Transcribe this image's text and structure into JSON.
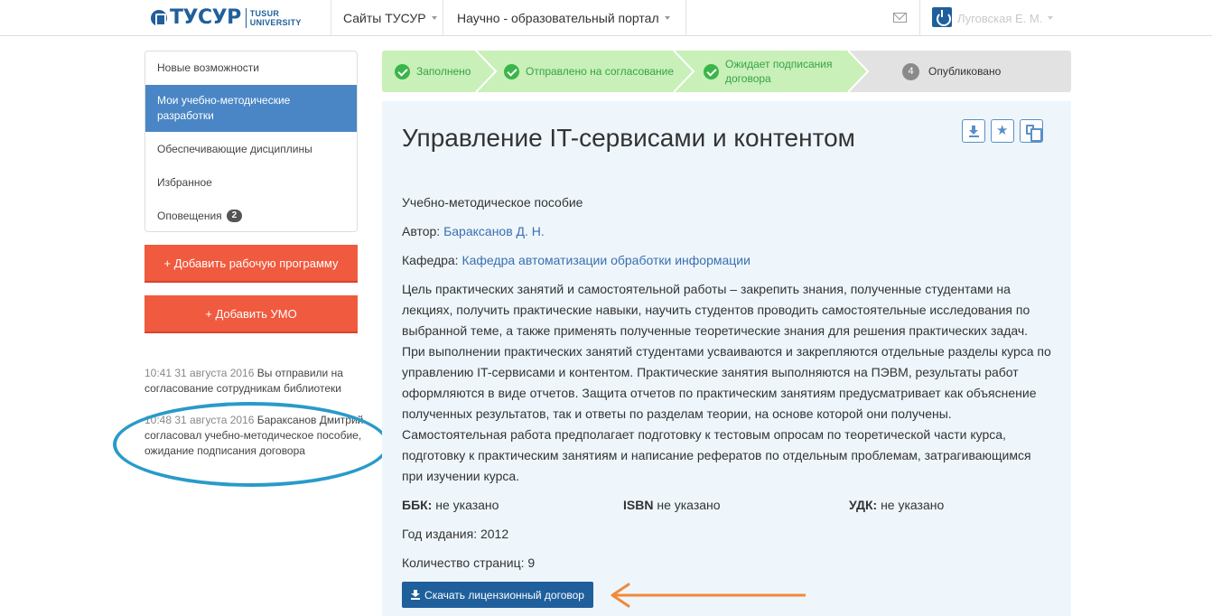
{
  "header": {
    "logo_main": "ТУСУР",
    "logo_sub_1": "TUSUR",
    "logo_sub_2": "UNIVERSITY",
    "menu": [
      "Сайты ТУСУР",
      "Научно - образовательный портал"
    ],
    "user": "Луговская Е. М."
  },
  "sidebar": {
    "items": [
      {
        "label": "Новые возможности"
      },
      {
        "label": "Мои учебно-методические разработки"
      },
      {
        "label": "Обеспечивающие дисциплины"
      },
      {
        "label": "Избранное"
      },
      {
        "label": "Оповещения",
        "badge": "2"
      }
    ],
    "add_program": "+ Добавить рабочую программу",
    "add_umo": "+ Добавить УМО",
    "log": [
      {
        "time": "10:41 31 августа 2016",
        "text": "Вы отправили на согласование сотрудникам библиотеки"
      },
      {
        "time": "10:48 31 августа 2016",
        "text": "Бараксанов Дмитрий согласовал учебно-методическое пособие, ожидание подписания договора"
      }
    ]
  },
  "steps": [
    {
      "label": "Заполнено",
      "state": "done"
    },
    {
      "label": "Отправлено на согласование",
      "state": "done"
    },
    {
      "label": "Ожидает подписания договора",
      "state": "done"
    },
    {
      "num": "4",
      "label": "Опубликовано",
      "state": "pending"
    }
  ],
  "document": {
    "title": "Управление IT-сервисами и контентом",
    "type": "Учебно-методическое пособие",
    "author_label": "Автор:",
    "author": "Бараксанов Д. Н.",
    "dept_label": "Кафедра:",
    "dept": "Кафедра автоматизации обработки информации",
    "description": "Цель практических занятий и самостоятельной работы – закрепить знания, полученные студентами на лекциях, получить практические навыки, научить студентов проводить самостоятельные исследования по выбранной теме, а также применять полученные теоретические знания для решения практических задач. При выполнении практических занятий студентами усваиваются и закрепляются отдельные разделы курса по управлению IT-сервисами и контентом. Практические занятия выполняются на ПЭВМ, результаты работ оформляются в виде отчетов. Защита отчетов по практическим занятиям предусматривает как объяснение полученных результатов, так и ответы по разделам теории, на основе которой они получены. Самостоятельная работа предполагает подготовку к тестовым опросам по теоретической части курса, подготовку к практическим занятиям и написание рефератов по отдельным проблемам, затрагивающимся при изучении курса.",
    "bbk_label": "ББК:",
    "bbk": "не указано",
    "isbn_label": "ISBN",
    "isbn": "не указано",
    "udk_label": "УДК:",
    "udk": "не указано",
    "year": "Год издания: 2012",
    "pages": "Количество страниц: 9",
    "download_button": "Скачать лицензионный договор"
  },
  "colors": {
    "brand": "#1f5f9c",
    "red_button": "#f05a3f",
    "step_done_bg": "#c8f0b8",
    "step_done_text": "#36a34a",
    "annotation_ellipse": "#2a9ac9",
    "annotation_arrow": "#f08a3a"
  }
}
